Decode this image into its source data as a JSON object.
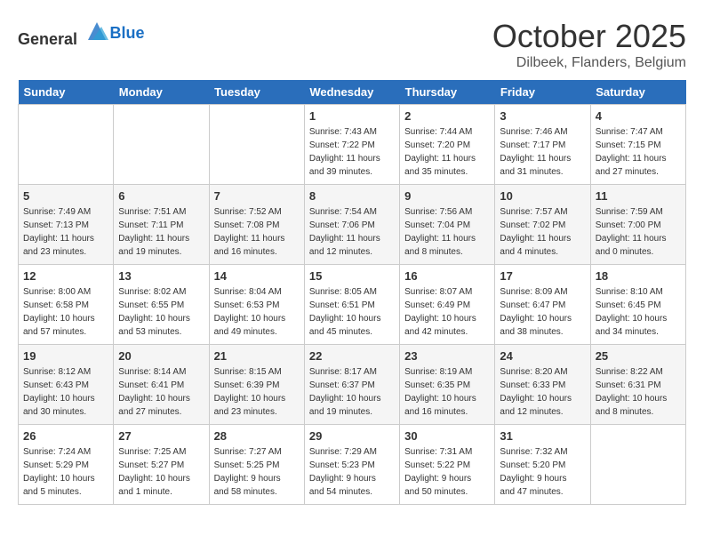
{
  "header": {
    "logo_general": "General",
    "logo_blue": "Blue",
    "month_year": "October 2025",
    "location": "Dilbeek, Flanders, Belgium"
  },
  "days_of_week": [
    "Sunday",
    "Monday",
    "Tuesday",
    "Wednesday",
    "Thursday",
    "Friday",
    "Saturday"
  ],
  "weeks": [
    [
      {
        "day": "",
        "info": ""
      },
      {
        "day": "",
        "info": ""
      },
      {
        "day": "",
        "info": ""
      },
      {
        "day": "1",
        "info": "Sunrise: 7:43 AM\nSunset: 7:22 PM\nDaylight: 11 hours\nand 39 minutes."
      },
      {
        "day": "2",
        "info": "Sunrise: 7:44 AM\nSunset: 7:20 PM\nDaylight: 11 hours\nand 35 minutes."
      },
      {
        "day": "3",
        "info": "Sunrise: 7:46 AM\nSunset: 7:17 PM\nDaylight: 11 hours\nand 31 minutes."
      },
      {
        "day": "4",
        "info": "Sunrise: 7:47 AM\nSunset: 7:15 PM\nDaylight: 11 hours\nand 27 minutes."
      }
    ],
    [
      {
        "day": "5",
        "info": "Sunrise: 7:49 AM\nSunset: 7:13 PM\nDaylight: 11 hours\nand 23 minutes."
      },
      {
        "day": "6",
        "info": "Sunrise: 7:51 AM\nSunset: 7:11 PM\nDaylight: 11 hours\nand 19 minutes."
      },
      {
        "day": "7",
        "info": "Sunrise: 7:52 AM\nSunset: 7:08 PM\nDaylight: 11 hours\nand 16 minutes."
      },
      {
        "day": "8",
        "info": "Sunrise: 7:54 AM\nSunset: 7:06 PM\nDaylight: 11 hours\nand 12 minutes."
      },
      {
        "day": "9",
        "info": "Sunrise: 7:56 AM\nSunset: 7:04 PM\nDaylight: 11 hours\nand 8 minutes."
      },
      {
        "day": "10",
        "info": "Sunrise: 7:57 AM\nSunset: 7:02 PM\nDaylight: 11 hours\nand 4 minutes."
      },
      {
        "day": "11",
        "info": "Sunrise: 7:59 AM\nSunset: 7:00 PM\nDaylight: 11 hours\nand 0 minutes."
      }
    ],
    [
      {
        "day": "12",
        "info": "Sunrise: 8:00 AM\nSunset: 6:58 PM\nDaylight: 10 hours\nand 57 minutes."
      },
      {
        "day": "13",
        "info": "Sunrise: 8:02 AM\nSunset: 6:55 PM\nDaylight: 10 hours\nand 53 minutes."
      },
      {
        "day": "14",
        "info": "Sunrise: 8:04 AM\nSunset: 6:53 PM\nDaylight: 10 hours\nand 49 minutes."
      },
      {
        "day": "15",
        "info": "Sunrise: 8:05 AM\nSunset: 6:51 PM\nDaylight: 10 hours\nand 45 minutes."
      },
      {
        "day": "16",
        "info": "Sunrise: 8:07 AM\nSunset: 6:49 PM\nDaylight: 10 hours\nand 42 minutes."
      },
      {
        "day": "17",
        "info": "Sunrise: 8:09 AM\nSunset: 6:47 PM\nDaylight: 10 hours\nand 38 minutes."
      },
      {
        "day": "18",
        "info": "Sunrise: 8:10 AM\nSunset: 6:45 PM\nDaylight: 10 hours\nand 34 minutes."
      }
    ],
    [
      {
        "day": "19",
        "info": "Sunrise: 8:12 AM\nSunset: 6:43 PM\nDaylight: 10 hours\nand 30 minutes."
      },
      {
        "day": "20",
        "info": "Sunrise: 8:14 AM\nSunset: 6:41 PM\nDaylight: 10 hours\nand 27 minutes."
      },
      {
        "day": "21",
        "info": "Sunrise: 8:15 AM\nSunset: 6:39 PM\nDaylight: 10 hours\nand 23 minutes."
      },
      {
        "day": "22",
        "info": "Sunrise: 8:17 AM\nSunset: 6:37 PM\nDaylight: 10 hours\nand 19 minutes."
      },
      {
        "day": "23",
        "info": "Sunrise: 8:19 AM\nSunset: 6:35 PM\nDaylight: 10 hours\nand 16 minutes."
      },
      {
        "day": "24",
        "info": "Sunrise: 8:20 AM\nSunset: 6:33 PM\nDaylight: 10 hours\nand 12 minutes."
      },
      {
        "day": "25",
        "info": "Sunrise: 8:22 AM\nSunset: 6:31 PM\nDaylight: 10 hours\nand 8 minutes."
      }
    ],
    [
      {
        "day": "26",
        "info": "Sunrise: 7:24 AM\nSunset: 5:29 PM\nDaylight: 10 hours\nand 5 minutes."
      },
      {
        "day": "27",
        "info": "Sunrise: 7:25 AM\nSunset: 5:27 PM\nDaylight: 10 hours\nand 1 minute."
      },
      {
        "day": "28",
        "info": "Sunrise: 7:27 AM\nSunset: 5:25 PM\nDaylight: 9 hours\nand 58 minutes."
      },
      {
        "day": "29",
        "info": "Sunrise: 7:29 AM\nSunset: 5:23 PM\nDaylight: 9 hours\nand 54 minutes."
      },
      {
        "day": "30",
        "info": "Sunrise: 7:31 AM\nSunset: 5:22 PM\nDaylight: 9 hours\nand 50 minutes."
      },
      {
        "day": "31",
        "info": "Sunrise: 7:32 AM\nSunset: 5:20 PM\nDaylight: 9 hours\nand 47 minutes."
      },
      {
        "day": "",
        "info": ""
      }
    ]
  ]
}
